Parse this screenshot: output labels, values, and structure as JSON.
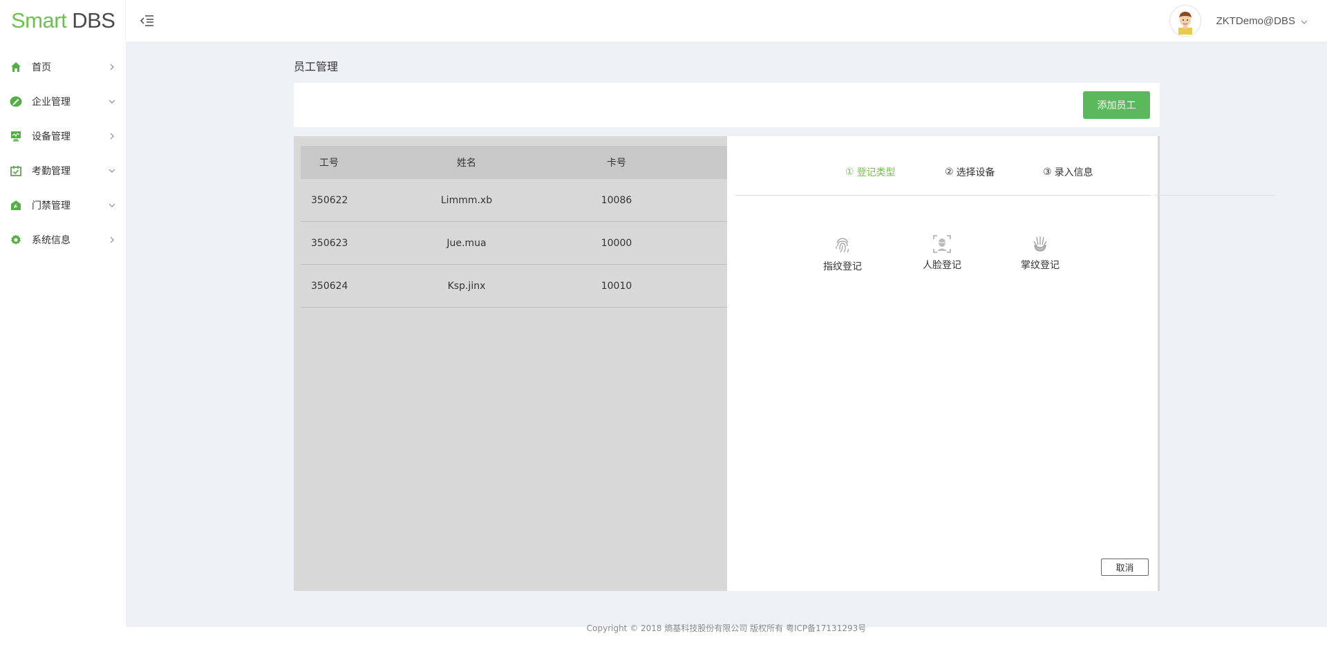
{
  "app": {
    "logo_smart": "Smart",
    "logo_dbs": "DBS",
    "username": "ZKTDemo@DBS"
  },
  "sidebar": {
    "items": [
      {
        "label": "首页",
        "icon": "home-icon",
        "arrow": "chevron-right-icon"
      },
      {
        "label": "企业管理",
        "icon": "enterprise-icon",
        "arrow": "chevron-down-icon"
      },
      {
        "label": "设备管理",
        "icon": "device-icon",
        "arrow": "chevron-right-icon"
      },
      {
        "label": "考勤管理",
        "icon": "attendance-icon",
        "arrow": "chevron-down-icon"
      },
      {
        "label": "门禁管理",
        "icon": "access-control-icon",
        "arrow": "chevron-down-icon"
      },
      {
        "label": "系统信息",
        "icon": "gear-icon",
        "arrow": "chevron-right-icon"
      }
    ]
  },
  "page": {
    "title": "员工管理",
    "add_button": "添加员工"
  },
  "table": {
    "headers": [
      "工号",
      "姓名",
      "卡号"
    ],
    "rows": [
      {
        "id": "350622",
        "name": "Limmm.xb",
        "card": "10086"
      },
      {
        "id": "350623",
        "name": "Jue.mua",
        "card": "10000"
      },
      {
        "id": "350624",
        "name": "Ksp.jinx",
        "card": "10010"
      }
    ]
  },
  "drawer": {
    "steps": [
      {
        "num": "①",
        "label": "登记类型"
      },
      {
        "num": "②",
        "label": "选择设备"
      },
      {
        "num": "③",
        "label": "录入信息"
      }
    ],
    "types": [
      {
        "label": "指纹登记",
        "icon": "fingerprint-icon"
      },
      {
        "label": "人脸登记",
        "icon": "face-scan-icon"
      },
      {
        "label": "掌纹登记",
        "icon": "palm-icon"
      }
    ],
    "cancel": "取消"
  },
  "footer": {
    "text": "Copyright © 2018 熵基科技股份有限公司 版权所有 粤ICP备17131293号"
  },
  "colors": {
    "accent": "#6cc24a",
    "button_green": "#5cb85c",
    "background": "#edf0f5",
    "overlay": "#d8d8d8"
  }
}
